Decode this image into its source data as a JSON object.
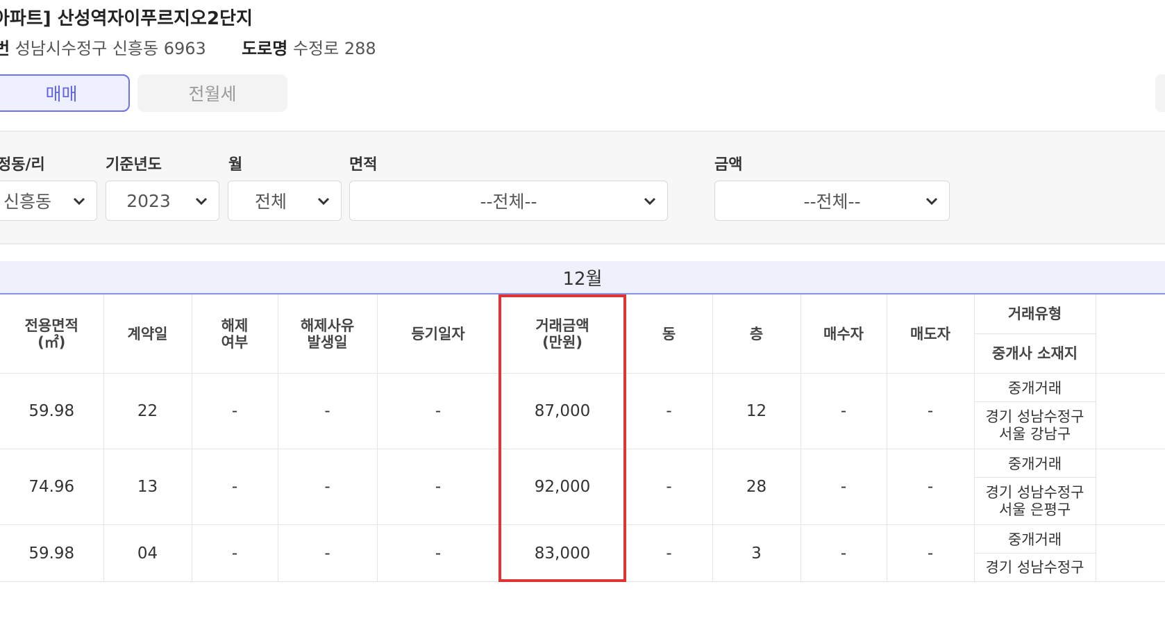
{
  "header": {
    "title": "아파트] 산성역자이푸르지오2단지",
    "jibun_label": "번",
    "jibun_value": "성남시수정구 신흥동 6963",
    "road_label": "도로명",
    "road_value": "수정로 288"
  },
  "tabs": {
    "sale": "매매",
    "rent": "전월세"
  },
  "filters": {
    "dong_label": "정동/리",
    "dong_value": "신흥동",
    "year_label": "기준년도",
    "year_value": "2023",
    "month_label": "월",
    "month_value": "전체",
    "area_label": "면적",
    "area_value": "--전체--",
    "price_label": "금액",
    "price_value": "--전체--"
  },
  "table": {
    "month_header": "12월",
    "columns": {
      "area": "전용면적\n(㎡)",
      "contract_day": "계약일",
      "cancel": "해제\n여부",
      "cancel_date": "해제사유\n발생일",
      "reg_date": "등기일자",
      "price": "거래금액\n(만원)",
      "building": "동",
      "floor": "층",
      "buyer": "매수자",
      "seller": "매도자",
      "trade_type": "거래유형",
      "agent_loc": "중개사 소재지"
    },
    "rows": [
      {
        "area": "59.98",
        "contract_day": "22",
        "cancel": "-",
        "cancel_date": "-",
        "reg_date": "-",
        "price": "87,000",
        "building": "-",
        "floor": "12",
        "buyer": "-",
        "seller": "-",
        "trade_type": "중개거래",
        "agent_loc": "경기 성남수정구\n서울 강남구"
      },
      {
        "area": "74.96",
        "contract_day": "13",
        "cancel": "-",
        "cancel_date": "-",
        "reg_date": "-",
        "price": "92,000",
        "building": "-",
        "floor": "28",
        "buyer": "-",
        "seller": "-",
        "trade_type": "중개거래",
        "agent_loc": "경기 성남수정구\n서울 은평구"
      },
      {
        "area": "59.98",
        "contract_day": "04",
        "cancel": "-",
        "cancel_date": "-",
        "reg_date": "-",
        "price": "83,000",
        "building": "-",
        "floor": "3",
        "buyer": "-",
        "seller": "-",
        "trade_type": "중개거래",
        "agent_loc": "경기 성남수정구"
      }
    ]
  },
  "colors": {
    "accent": "#5e63e8",
    "highlight": "#e03434"
  }
}
